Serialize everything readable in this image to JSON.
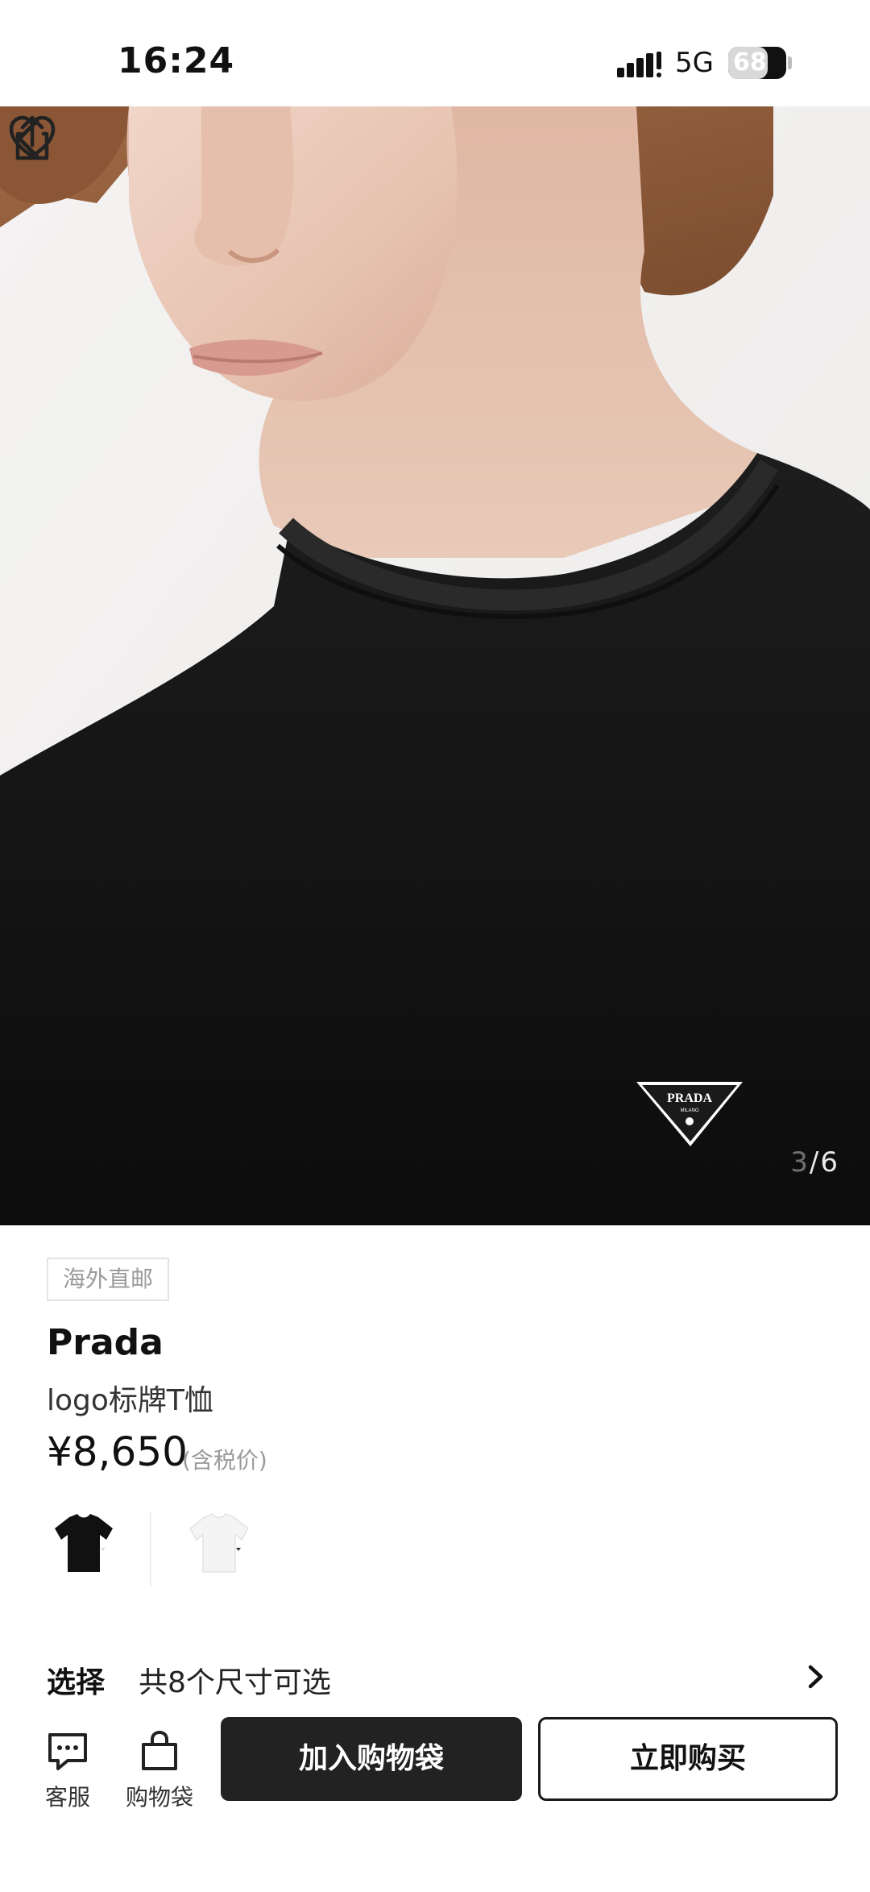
{
  "status_bar": {
    "time": "16:24",
    "network": "5G",
    "battery": "68",
    "battery_level": 0.68
  },
  "gallery": {
    "current": "3",
    "total": "/6",
    "icons": [
      "chevron-left-icon",
      "share-icon",
      "heart-icon"
    ]
  },
  "product": {
    "tag": "海外直邮",
    "brand": "Prada",
    "name": "logo标牌T恤",
    "price": "¥8,650",
    "price_note": "(含税价)",
    "logo_text": "PRADA",
    "logo_subtext": "MILANO"
  },
  "variants": [
    {
      "color": "#111111"
    },
    {
      "color": "#f4f4f4"
    }
  ],
  "size_select": {
    "label": "选择",
    "value": "共8个尺寸可选"
  },
  "bottom_bar": {
    "service_label": "客服",
    "bag_label": "购物袋",
    "add_to_bag": "加入购物袋",
    "buy_now": "立即购买"
  },
  "colors": {
    "primary_button": "#222222",
    "tag_border": "#e3e3e3",
    "muted_text": "#9a9a9a"
  }
}
